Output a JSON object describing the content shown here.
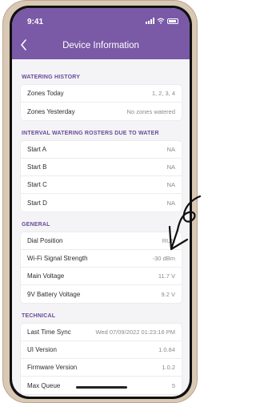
{
  "status_bar": {
    "time": "9:41"
  },
  "nav": {
    "back_icon": "chevron-left-icon",
    "title": "Device Information"
  },
  "sections": [
    {
      "title": "WATERING HISTORY",
      "rows": [
        {
          "label": "Zones Today",
          "value": "1, 2, 3, 4"
        },
        {
          "label": "Zones Yesterday",
          "value": "No zones watered"
        }
      ]
    },
    {
      "title": "INTERVAL WATERING ROSTERS DUE TO WATER",
      "rows": [
        {
          "label": "Start A",
          "value": "NA"
        },
        {
          "label": "Start B",
          "value": "NA"
        },
        {
          "label": "Start C",
          "value": "NA"
        },
        {
          "label": "Start D",
          "value": "NA"
        }
      ]
    },
    {
      "title": "GENERAL",
      "rows": [
        {
          "label": "Dial Position",
          "value": "RUN"
        },
        {
          "label": "Wi-Fi Signal Strength",
          "value": "-30 dBm"
        },
        {
          "label": "Main Voltage",
          "value": "11.7 V"
        },
        {
          "label": "9V Battery Voltage",
          "value": "9.2 V"
        }
      ]
    },
    {
      "title": "TECHNICAL",
      "rows": [
        {
          "label": "Last Time Sync",
          "value": "Wed 07/09/2022 01:23:16 PM"
        },
        {
          "label": "UI Version",
          "value": "1.0.84"
        },
        {
          "label": "Firmware Version",
          "value": "1.0.2"
        },
        {
          "label": "Max Queue",
          "value": "5"
        }
      ]
    }
  ],
  "colors": {
    "header": "#7a59a6",
    "section_title": "#6a4a98",
    "screen_bg": "#f4f4f6"
  },
  "annotation_icon": "hand-drawn-arrow-icon"
}
